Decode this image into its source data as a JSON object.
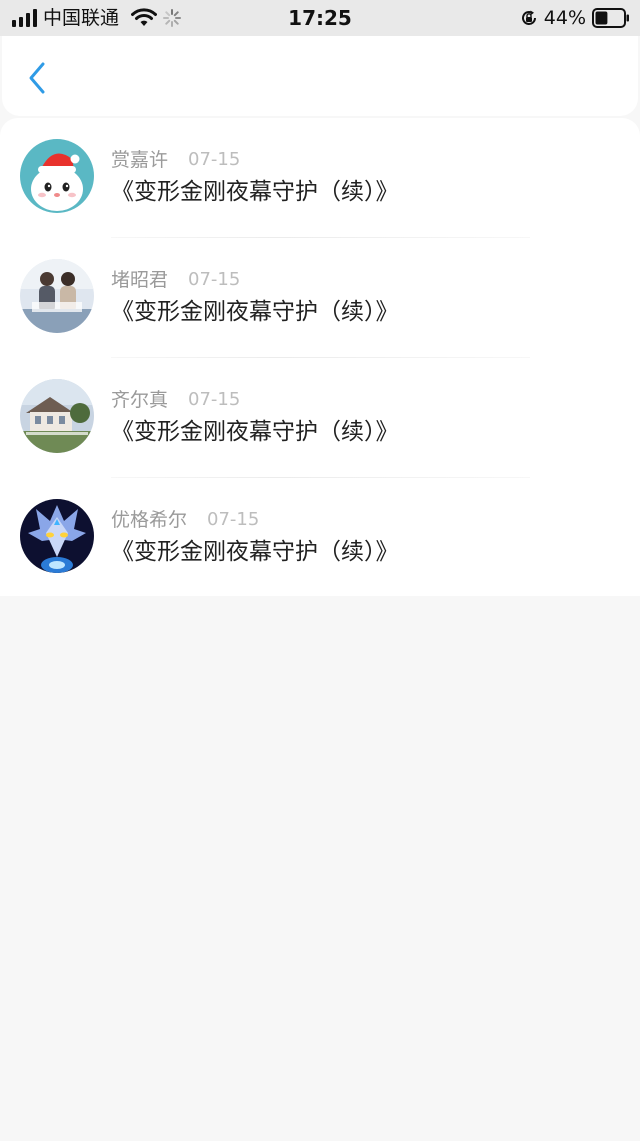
{
  "status_bar": {
    "carrier": "中国联通",
    "time": "17:25",
    "battery": "44%",
    "battery_level": 0.44
  },
  "nav": {
    "back_icon": "chevron-left-icon",
    "accent": "#2f9be6"
  },
  "items": [
    {
      "name": "赏嘉许",
      "date": "07-15",
      "title": "《变形金刚夜幕守护（续）》",
      "avatar": "snowman-avatar"
    },
    {
      "name": "堵昭君",
      "date": "07-15",
      "title": "《变形金刚夜幕守护（续）》",
      "avatar": "couple-photo-avatar"
    },
    {
      "name": "齐尔真",
      "date": "07-15",
      "title": "《变形金刚夜幕守护（续）》",
      "avatar": "house-photo-avatar"
    },
    {
      "name": "优格希尔",
      "date": "07-15",
      "title": "《变形金刚夜幕守护（续）》",
      "avatar": "armored-character-avatar"
    }
  ]
}
